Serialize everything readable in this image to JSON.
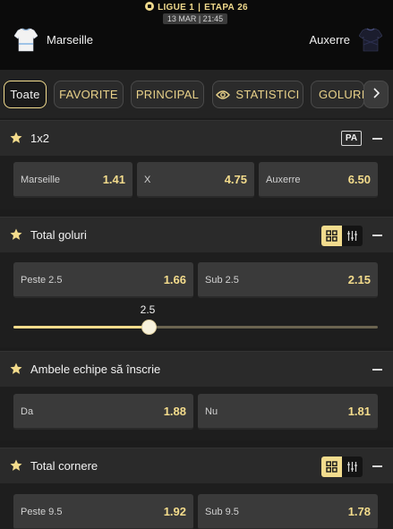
{
  "header": {
    "league": "LIGUE 1",
    "stage": "ETAPA",
    "round": "26",
    "datetime": "13 MAR | 21:45",
    "home_team": "Marseille",
    "away_team": "Auxerre"
  },
  "filters": {
    "tabs": [
      "Toate",
      "FAVORITE",
      "PRINCIPAL",
      "STATISTICI",
      "GOLURI"
    ],
    "active": "Toate"
  },
  "markets": {
    "result": {
      "title": "1x2",
      "badge": "PA",
      "odds": [
        {
          "label": "Marseille",
          "value": "1.41"
        },
        {
          "label": "X",
          "value": "4.75"
        },
        {
          "label": "Auxerre",
          "value": "6.50"
        }
      ]
    },
    "total_goals": {
      "title": "Total goluri",
      "odds": [
        {
          "label": "Peste 2.5",
          "value": "1.66"
        },
        {
          "label": "Sub 2.5",
          "value": "2.15"
        }
      ],
      "slider_value": "2.5",
      "slider_fraction": 0.37
    },
    "btts": {
      "title": "Ambele echipe să înscrie",
      "odds": [
        {
          "label": "Da",
          "value": "1.88"
        },
        {
          "label": "Nu",
          "value": "1.81"
        }
      ]
    },
    "total_corners": {
      "title": "Total cornere",
      "odds": [
        {
          "label": "Peste 9.5",
          "value": "1.92"
        },
        {
          "label": "Sub 9.5",
          "value": "1.78"
        }
      ]
    }
  },
  "colors": {
    "accent": "#f4dc8c",
    "background": "#1c1c1c",
    "odd_button": "#3a3a3a"
  },
  "icons": [
    "soccer-ball-icon",
    "home-jersey-icon",
    "away-jersey-icon",
    "eye-icon",
    "chevron-right-icon",
    "star-icon",
    "collapse-icon",
    "grid-view-icon",
    "list-view-icon"
  ]
}
